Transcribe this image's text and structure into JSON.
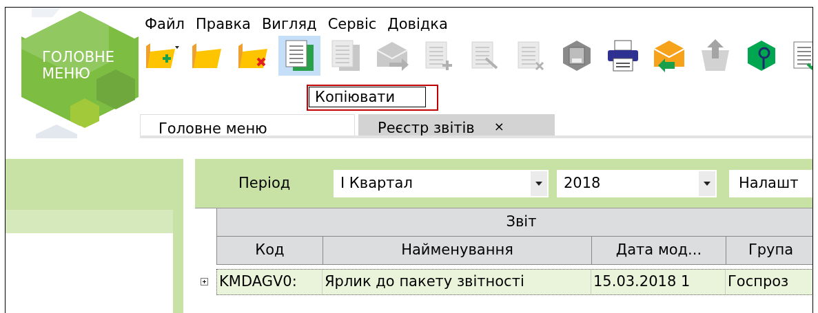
{
  "logo": {
    "lines": [
      "ГОЛОВНЕ",
      "МЕНЮ"
    ]
  },
  "menu": [
    {
      "label": "Файл"
    },
    {
      "label": "Правка"
    },
    {
      "label": "Вигляд"
    },
    {
      "label": "Сервіс"
    },
    {
      "label": "Довідка"
    }
  ],
  "toolbar": [
    {
      "kind": "folder-add",
      "selected": false,
      "disabled": false
    },
    {
      "kind": "folder",
      "selected": false,
      "disabled": false
    },
    {
      "kind": "folder-delete",
      "selected": false,
      "disabled": false
    },
    {
      "kind": "copy",
      "selected": true,
      "disabled": false
    },
    {
      "kind": "copy-alt",
      "selected": false,
      "disabled": true
    },
    {
      "kind": "mail-forward",
      "selected": false,
      "disabled": true
    },
    {
      "kind": "doc-add",
      "selected": false,
      "disabled": true
    },
    {
      "kind": "doc-edit",
      "selected": false,
      "disabled": true
    },
    {
      "kind": "doc-delete",
      "selected": false,
      "disabled": true
    },
    {
      "kind": "disk",
      "selected": false,
      "disabled": false
    },
    {
      "kind": "printer",
      "selected": false,
      "disabled": false
    },
    {
      "kind": "mail-receive",
      "selected": false,
      "disabled": false
    },
    {
      "kind": "trash-up",
      "selected": false,
      "disabled": true
    },
    {
      "kind": "search",
      "selected": false,
      "disabled": false
    },
    {
      "kind": "doc-check",
      "selected": false,
      "disabled": false
    }
  ],
  "tooltip": {
    "text": "Копіювати"
  },
  "tabs": [
    {
      "label": "Головне меню",
      "selected": false
    },
    {
      "label": "Реєстр звітів",
      "selected": true,
      "close": "×"
    }
  ],
  "filters": {
    "label": "Період",
    "period": {
      "value": "I Квартал"
    },
    "year": {
      "value": "2018"
    },
    "settings": {
      "label": "Налашт"
    }
  },
  "table": {
    "group_header": "Звіт",
    "columns": [
      "Код",
      "Найменування",
      "Дата мод...",
      "Група"
    ],
    "rows": [
      {
        "selected": true,
        "expanded": false,
        "cells": [
          "KMDAGV0:",
          "Ярлик до пакету звітності",
          "15.03.2018 1",
          "Госпроз"
        ]
      }
    ]
  }
}
